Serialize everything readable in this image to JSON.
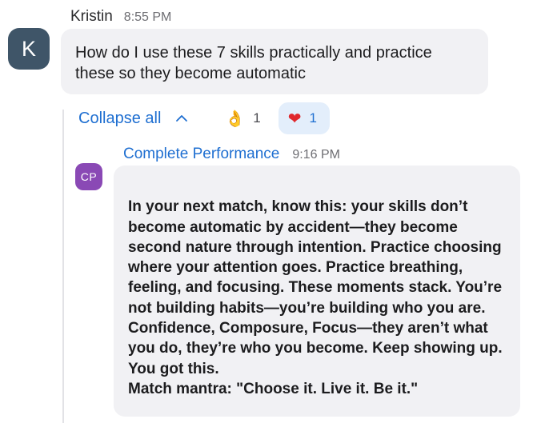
{
  "parent_message": {
    "sender": "Kristin",
    "time": "8:55 PM",
    "avatar_initial": "K",
    "text": "How do I use these 7 skills practically and practice these so they become automatic"
  },
  "thread": {
    "collapse_label": "Collapse all",
    "reactions": [
      {
        "icon": "ok-hand-icon",
        "count": "1",
        "selected": false
      },
      {
        "icon": "red-heart-icon",
        "count": "1",
        "selected": true
      }
    ]
  },
  "reply": {
    "sender": "Complete Performance",
    "time": "9:16 PM",
    "avatar_initials": "CP",
    "text": "In your next match, know this: your skills don’t become automatic by accident—they become second nature through intention. Practice choosing where your attention goes. Practice breathing, feeling, and focusing. These moments stack. You’re not building habits—you’re building who you are. Confidence, Composure, Focus—they aren’t what you do, they’re who you become. Keep showing up. You got this.\nMatch mantra: \"Choose it. Live it. Be it.\""
  },
  "colors": {
    "link_blue": "#1f6fd1",
    "bubble_bg": "#f1f1f4",
    "avatar_k_bg": "#3f5568",
    "avatar_cp_bg": "#8a49b5",
    "selected_reaction_bg": "#e3eefb"
  }
}
